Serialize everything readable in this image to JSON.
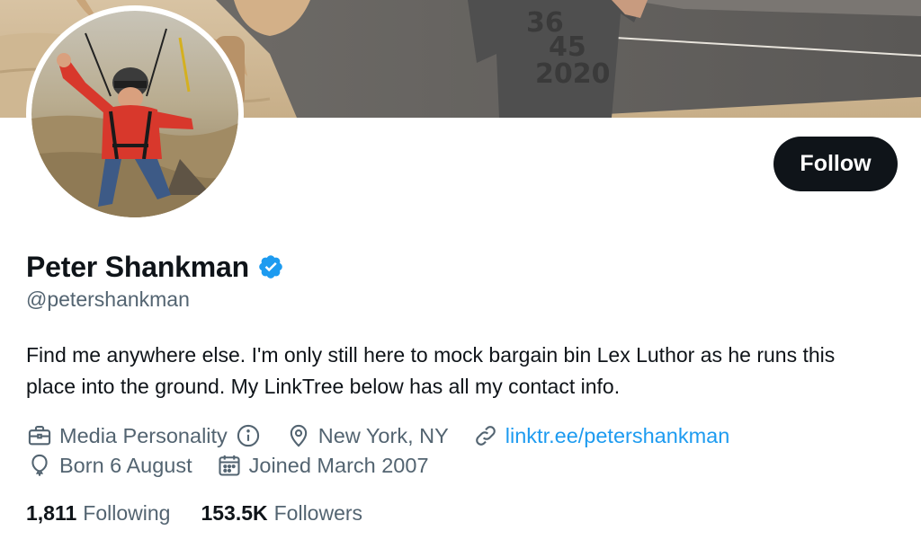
{
  "profile": {
    "display_name": "Peter Shankman",
    "handle": "@petershankman",
    "bio": "Find me anywhere else. I'm only still here to mock bargain bin Lex Luthor as he runs this place into the ground. My LinkTree below has all my contact info.",
    "follow_label": "Follow",
    "verified": true
  },
  "meta": {
    "profession": "Media Personality",
    "location": "New York, NY",
    "website": "linktr.ee/petershankman",
    "birthday": "Born 6 August",
    "joined": "Joined March 2007"
  },
  "stats": {
    "following_count": "1,811",
    "following_label": "Following",
    "followers_count": "153.5K",
    "followers_label": "Followers"
  },
  "banner": {
    "shirt_text": [
      "36",
      "45",
      "2020"
    ]
  },
  "colors": {
    "primary_text": "#0f1419",
    "secondary_text": "#536471",
    "link": "#1d9bf0",
    "verified_badge": "#1d9bf0",
    "follow_button_bg": "#0f1419"
  },
  "icons": {
    "profession": "briefcase-icon",
    "info": "info-icon",
    "location": "location-pin-icon",
    "website": "link-icon",
    "birthday": "balloon-icon",
    "joined": "calendar-icon",
    "verified": "verified-badge-icon"
  }
}
